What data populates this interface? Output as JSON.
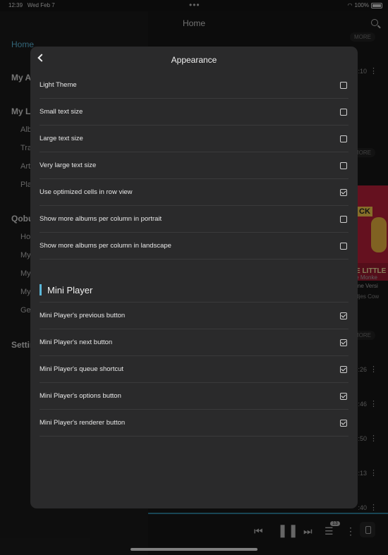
{
  "status_bar": {
    "time": "12:39",
    "date": "Wed Feb 7",
    "dots": "•••",
    "battery": "100%",
    "wifi_icon": "wifi-icon"
  },
  "sidebar": {
    "items": [
      {
        "label": "Home",
        "kind": "active"
      },
      {
        "label": "My A",
        "kind": "header"
      },
      {
        "label": "My Li",
        "kind": "header"
      },
      {
        "label": "Alb",
        "kind": "sub"
      },
      {
        "label": "Tra",
        "kind": "sub"
      },
      {
        "label": "Art",
        "kind": "sub"
      },
      {
        "label": "Pla",
        "kind": "sub"
      },
      {
        "label": "Qobu",
        "kind": "header"
      },
      {
        "label": "Ho",
        "kind": "sub"
      },
      {
        "label": "My",
        "kind": "sub"
      },
      {
        "label": "My",
        "kind": "sub"
      },
      {
        "label": "My",
        "kind": "sub"
      },
      {
        "label": "Ge",
        "kind": "sub"
      },
      {
        "label": "Settin",
        "kind": "header"
      }
    ]
  },
  "main": {
    "title": "Home",
    "more_label": "MORE",
    "durations": [
      ":10",
      ":26",
      ":46",
      ":50",
      ":13",
      ":40"
    ],
    "album": {
      "cover_text": "E LITTLE",
      "cover_tag": "CK",
      "line1": "ttle Monke",
      "line2": "hone Versi",
      "line3": "ledjes Cow"
    }
  },
  "modal": {
    "title": "Appearance",
    "settings": [
      {
        "label": "Light Theme",
        "checked": false
      },
      {
        "label": "Small text size",
        "checked": false
      },
      {
        "label": "Large text size",
        "checked": false
      },
      {
        "label": "Very large text size",
        "checked": false
      },
      {
        "label": "Use optimized cells in row view",
        "checked": true
      },
      {
        "label": "Show more albums per column in portrait",
        "checked": false
      },
      {
        "label": "Show more albums per column in landscape",
        "checked": false
      }
    ],
    "mini_player_title": "Mini Player",
    "mini_player": [
      {
        "label": "Mini Player's previous button",
        "checked": true
      },
      {
        "label": "Mini Player's next button",
        "checked": true
      },
      {
        "label": "Mini Player's queue shortcut",
        "checked": true
      },
      {
        "label": "Mini Player's options button",
        "checked": true
      },
      {
        "label": "Mini Player's renderer button",
        "checked": true
      }
    ]
  },
  "player": {
    "queue_count": "13",
    "accent_color": "#2c7f99"
  },
  "colors": {
    "accent": "#5bb7d9",
    "modal_bg": "#2a2a2b"
  }
}
